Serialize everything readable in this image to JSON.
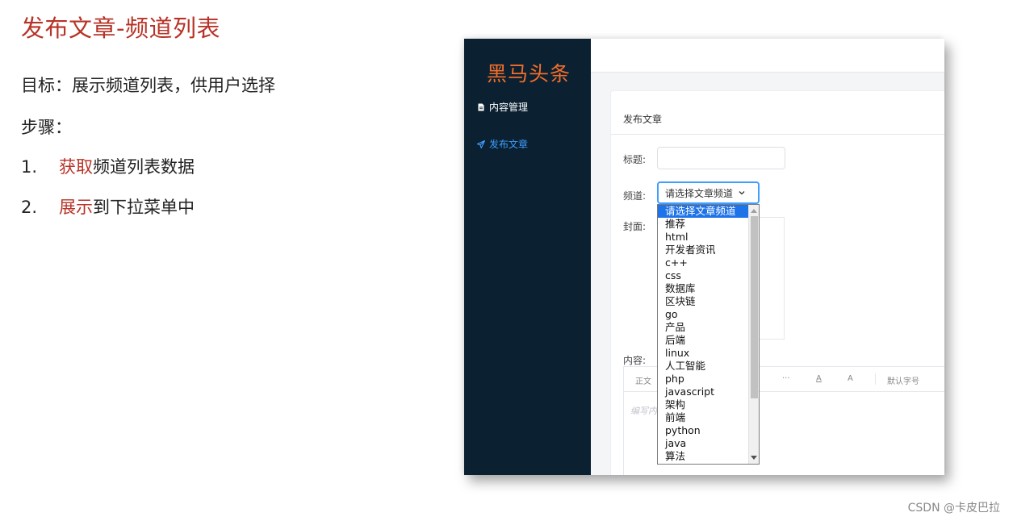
{
  "slide": {
    "title": "发布文章-频道列表",
    "goal": "目标：展示频道列表，供用户选择",
    "steps_label": "步骤：",
    "steps": [
      {
        "num": "1.",
        "highlight": "获取",
        "rest": "频道列表数据"
      },
      {
        "num": "2.",
        "highlight": "展示",
        "rest": "到下拉菜单中"
      }
    ],
    "accent_color": "#b83327"
  },
  "app": {
    "logo": "黑马头条",
    "nav": [
      {
        "label": "内容管理",
        "icon": "document-icon"
      },
      {
        "label": "发布文章",
        "icon": "paper-plane-icon"
      }
    ],
    "sidebar_color": "#0b2031",
    "logo_color": "#f26e2b",
    "active_color": "#3f9eff"
  },
  "form": {
    "breadcrumb": "发布文章",
    "title_label": "标题:",
    "channel_label": "频道:",
    "cover_label": "封面:",
    "content_label": "内容:",
    "channel_selected": "请选择文章频道",
    "editor_placeholder": "编写内"
  },
  "toolbar": {
    "items": [
      "正文",
      "···",
      "A",
      "A",
      "默认字号"
    ]
  },
  "dropdown": {
    "options": [
      "请选择文章频道",
      "推荐",
      "html",
      "开发者资讯",
      "c++",
      "css",
      "数据库",
      "区块链",
      "go",
      "产品",
      "后端",
      "linux",
      "人工智能",
      "php",
      "javascript",
      "架构",
      "前端",
      "python",
      "java",
      "算法"
    ],
    "selected_index": 0
  },
  "watermark": "CSDN @卡皮巴拉"
}
